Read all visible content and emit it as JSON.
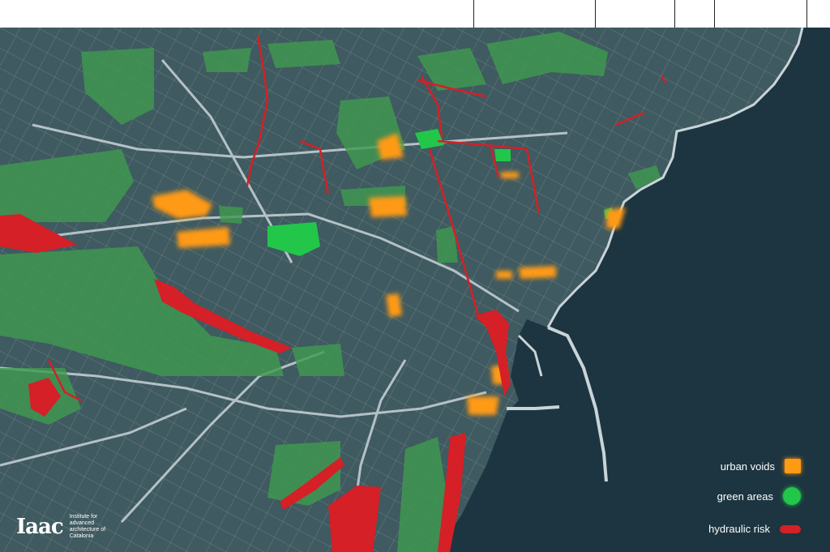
{
  "colors": {
    "land": "#3f5a60",
    "sea": "#1c3540",
    "roads": "#b9c6cc",
    "urban_voids": "#ff9a12",
    "green_areas": "#22c74a",
    "green_areas_muted": "#3f9a4f",
    "hydraulic_risk": "#d42026"
  },
  "legend": [
    {
      "label": "urban voids",
      "icon": "orange-square-swatch"
    },
    {
      "label": "green areas",
      "icon": "green-circle-swatch"
    },
    {
      "label": "hydraulic risk",
      "icon": "red-line-swatch"
    }
  ],
  "logo": {
    "mark": "Iaac",
    "text": "Institute for advanced architecture of Catalonia"
  }
}
